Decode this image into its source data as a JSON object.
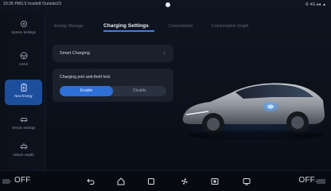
{
  "status_bar": {
    "left_text": "10:36 PM3.5 Inside8 Outside23",
    "right_text": "令 4G  ●● ▲"
  },
  "sidebar": {
    "items": [
      {
        "label": "System Settings",
        "icon": "gear-icon"
      },
      {
        "label": "ADAS",
        "icon": "steering-wheel-icon"
      },
      {
        "label": "New Energy",
        "icon": "battery-icon",
        "active": true
      },
      {
        "label": "Vehicle Settings",
        "icon": "car-icon"
      },
      {
        "label": "Vehicle Health",
        "icon": "car-health-icon"
      }
    ]
  },
  "tabs": [
    {
      "label": "Energy Manage"
    },
    {
      "label": "Charging Settings",
      "active": true
    },
    {
      "label": "Consumption"
    },
    {
      "label": "Consumption Graph"
    }
  ],
  "smart_charging": {
    "title": "Smart Charging",
    "chevron": "›"
  },
  "antitheft_lock": {
    "title": "Charging port anti-theft lock",
    "options": [
      "Enable",
      "Disable"
    ],
    "selected": "Enable"
  },
  "dock": {
    "left_off": "OFF",
    "right_off": "OFF",
    "icons": [
      "back-icon",
      "home-icon",
      "recent-apps-icon",
      "fan-icon",
      "media-icon",
      "monitor-icon"
    ]
  },
  "colors": {
    "accent": "#2f6fd8",
    "sidebar_active": "#1d4e9c",
    "card_bg": "#1a212d"
  }
}
